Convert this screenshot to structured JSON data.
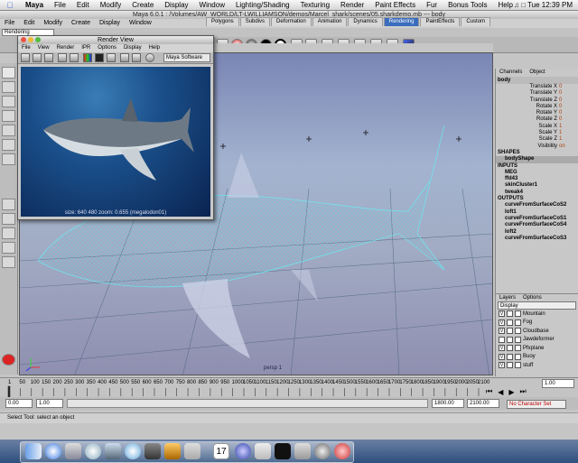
{
  "menubar": {
    "app": "Maya",
    "items": [
      "File",
      "Edit",
      "Modify",
      "Create",
      "Display",
      "Window",
      "Lighting/Shading",
      "Texturing",
      "Render",
      "Paint Effects",
      "Fur",
      "Bonus Tools",
      "Help"
    ],
    "clock": "Tue 12:39 PM"
  },
  "window": {
    "title": "Maya 6.0.1 : /Volumes/AW_WORLD/LT-LWILLIAMSON/demos/Marcel_shark/scenes/05.sharkdemo.mb  ---  body"
  },
  "mode_menu": "Rendering",
  "shelf_tabs": [
    "Polygons",
    "Subdivs",
    "Deformation",
    "Animation",
    "Dynamics",
    "Rendering",
    "PaintEffects",
    "Custom"
  ],
  "active_shelf": "Rendering",
  "render_view": {
    "title": "Render View",
    "menu": [
      "File",
      "View",
      "Render",
      "IPR",
      "Options",
      "Display",
      "Help"
    ],
    "renderer": "Maya Software",
    "caption": "size: 640 480 zoom: 0.655 (megalodon01)"
  },
  "viewport": {
    "camera_label": "persp 1"
  },
  "channel_box": {
    "tabs": [
      "Channels",
      "Object"
    ],
    "object": "body",
    "attributes": [
      {
        "name": "Translate X",
        "value": "0"
      },
      {
        "name": "Translate Y",
        "value": "0"
      },
      {
        "name": "Translate Z",
        "value": "0"
      },
      {
        "name": "Rotate X",
        "value": "0"
      },
      {
        "name": "Rotate Y",
        "value": "0"
      },
      {
        "name": "Rotate Z",
        "value": "0"
      },
      {
        "name": "Scale X",
        "value": "1"
      },
      {
        "name": "Scale Y",
        "value": "1"
      },
      {
        "name": "Scale Z",
        "value": "1"
      },
      {
        "name": "Visibility",
        "value": "on"
      }
    ],
    "shapes_label": "SHAPES",
    "shapes": [
      "bodyShape"
    ],
    "inputs_label": "INPUTS",
    "inputs": [
      "MEG",
      "ffd43",
      "skinCluster1",
      "tweak4"
    ],
    "outputs_label": "OUTPUTS",
    "outputs": [
      "curveFromSurfaceCoS2",
      "loft1",
      "curveFromSurfaceCoS1",
      "curveFromSurfaceCoS4",
      "loft2",
      "curveFromSurfaceCoS3"
    ]
  },
  "layers": {
    "tabs": [
      "Layers",
      "Options"
    ],
    "dropdown": "Display",
    "items": [
      "Mountain",
      "Fog",
      "Cloudbase",
      "Jawdeformer",
      "Pfxplane",
      "Buoy",
      "stuff"
    ]
  },
  "timeline": {
    "ticks": [
      "1",
      "50",
      "100",
      "150",
      "200",
      "250",
      "300",
      "350",
      "400",
      "450",
      "500",
      "550",
      "600",
      "650",
      "700",
      "750",
      "800",
      "850",
      "900",
      "950",
      "1000",
      "1050",
      "1100",
      "1150",
      "1200",
      "1250",
      "1300",
      "1350",
      "1400",
      "1450",
      "1500",
      "1550",
      "1600",
      "1650",
      "1700",
      "1750",
      "1800",
      "1850",
      "1900",
      "1950",
      "2000",
      "2050",
      "2100"
    ],
    "current_frame": "1.00"
  },
  "range": {
    "start": "0.00",
    "start2": "1.00",
    "end": "1800.00",
    "end2": "2100.00",
    "character_set": "No Character Set"
  },
  "help_line": "Select Tool: select an object",
  "colors": {
    "active_tab": "#3a6dbd",
    "viewport_top": "#7a85b4",
    "viewport_mid": "#a3b3cf",
    "wire": "#5fd9e6",
    "attr_value": "#a41"
  }
}
